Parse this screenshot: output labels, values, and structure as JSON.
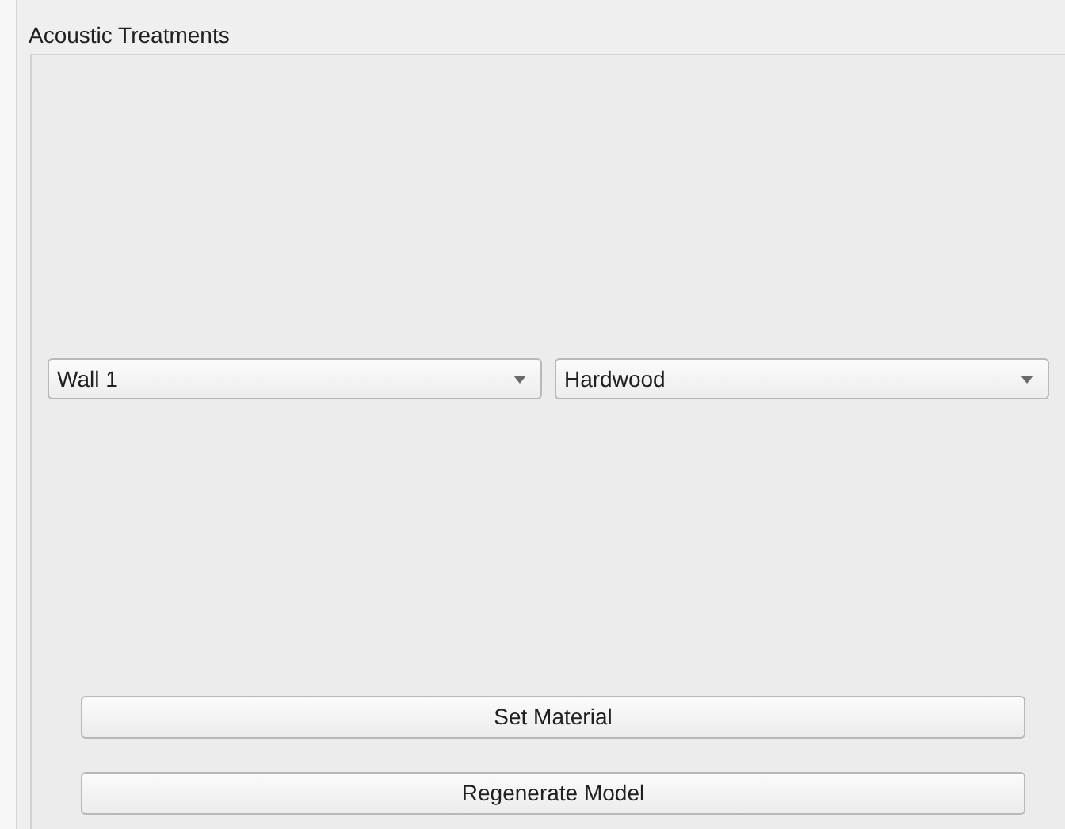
{
  "group": {
    "title": "Acoustic Treatments"
  },
  "dropdowns": [
    {
      "value": "Wall 1"
    },
    {
      "value": "Hardwood"
    }
  ],
  "buttons": [
    "Set Material",
    "Regenerate Model"
  ]
}
